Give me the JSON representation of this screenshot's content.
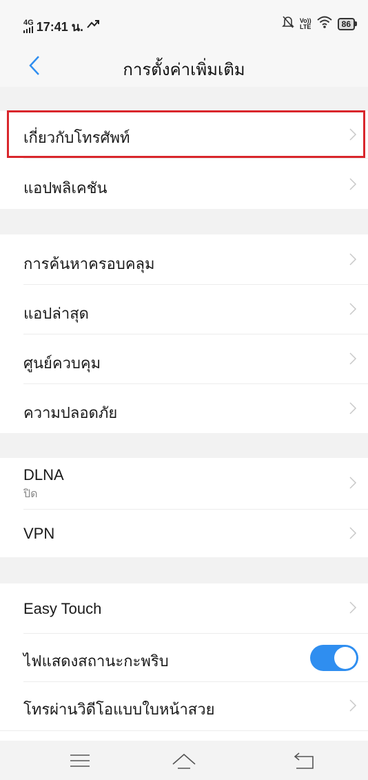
{
  "status_bar": {
    "network": "4G",
    "time": "17:41 น.",
    "volte": "Vo))",
    "lte": "LTE",
    "battery": "86"
  },
  "header": {
    "title": "การตั้งค่าเพิ่มเติม"
  },
  "rows": [
    {
      "label": "เกี่ยวกับโทรศัพท์"
    },
    {
      "label": "แอปพลิเคชัน"
    },
    {
      "label": "การค้นหาครอบคลุม"
    },
    {
      "label": "แอปล่าสุด"
    },
    {
      "label": "ศูนย์ควบคุม"
    },
    {
      "label": "ความปลอดภัย"
    },
    {
      "label": "DLNA",
      "sub": "ปิด"
    },
    {
      "label": "VPN"
    },
    {
      "label": "Easy Touch"
    },
    {
      "label": "ไฟแสดงสถานะกะพริบ",
      "toggle_on": true
    },
    {
      "label": "โทรผ่านวิดีโอแบบใบหน้าสวย"
    }
  ],
  "colors": {
    "accent": "#2f8ef0",
    "highlight": "#d9262c"
  },
  "icons": [
    "back-arrow-icon",
    "chevron-right-icon",
    "menu-icon",
    "home-icon",
    "back-icon"
  ]
}
